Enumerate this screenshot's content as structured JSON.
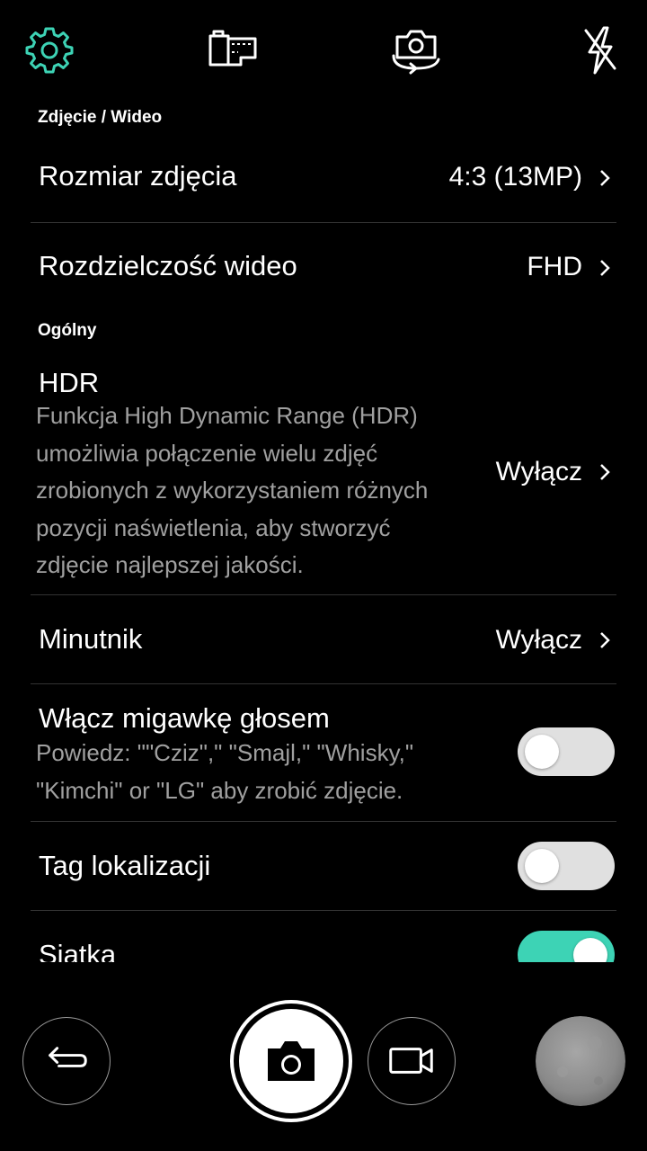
{
  "colors": {
    "accent": "#3dd3b5",
    "background": "#000000",
    "divider": "#333333",
    "secondary_text": "#a0a0a0"
  },
  "topbar": {
    "icons": [
      "gear-icon",
      "film-strip-icon",
      "switch-camera-icon",
      "flash-off-icon"
    ]
  },
  "sections": {
    "photo_video": "Zdjęcie / Wideo",
    "general": "Ogólny"
  },
  "settings": {
    "photo_size": {
      "title": "Rozmiar zdjęcia",
      "value": "4:3 (13MP)"
    },
    "video_resolution": {
      "title": "Rozdzielczość wideo",
      "value": "FHD"
    },
    "hdr": {
      "title": "HDR",
      "description": "Funkcja High Dynamic Range (HDR) umożliwia połączenie wielu zdjęć zrobionych z wykorzystaniem różnych pozycji naświetlenia, aby stworzyć zdjęcie najlepszej jakości.",
      "value": "Wyłącz"
    },
    "timer": {
      "title": "Minutnik",
      "value": "Wyłącz"
    },
    "voice_shutter": {
      "title": "Włącz migawkę głosem",
      "description": "Powiedz: \"\"Cziz\",\" \"Smajl,\" \"Whisky,\" \"Kimchi\" or \"LG\" aby zrobić zdjęcie.",
      "enabled": false
    },
    "location_tag": {
      "title": "Tag lokalizacji",
      "enabled": false
    },
    "grid": {
      "title": "Siatka",
      "enabled": true
    }
  },
  "bottombar": {
    "icons": [
      "back-icon",
      "shutter-camera-icon",
      "video-camera-icon",
      "gallery-thumbnail"
    ]
  }
}
